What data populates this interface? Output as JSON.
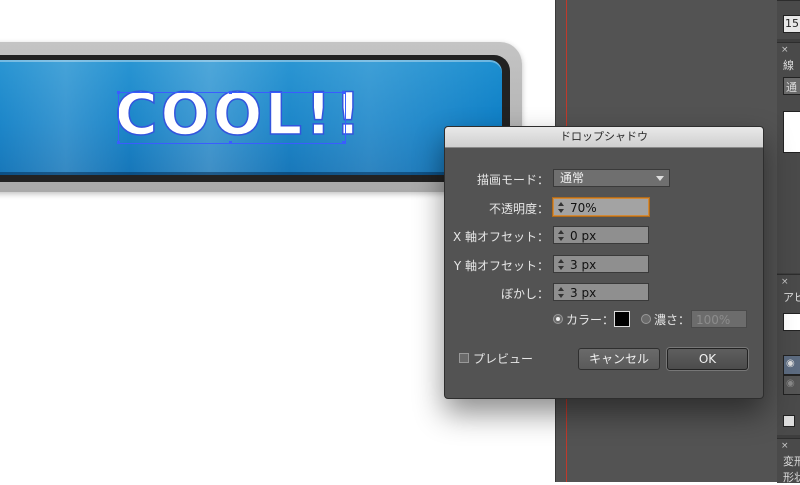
{
  "artboard": {
    "button_text": "COOL!!",
    "button_color": "#0f7fc6"
  },
  "dialog": {
    "title": "ドロップシャドウ",
    "mode": {
      "label": "描画モード：",
      "value": "通常"
    },
    "opacity": {
      "label": "不透明度：",
      "value": "70%"
    },
    "x_offset": {
      "label": "X 軸オフセット：",
      "value": "0 px"
    },
    "y_offset": {
      "label": "Y 軸オフセット：",
      "value": "3 px"
    },
    "blur": {
      "label": "ぼかし：",
      "value": "3 px"
    },
    "color_option": {
      "label": "カラー：",
      "selected": true,
      "swatch": "#000000"
    },
    "darkness_option": {
      "label": "濃さ：",
      "value": "100%",
      "selected": false
    },
    "preview": {
      "label": "プレビュー",
      "checked": false
    },
    "cancel_label": "キャンセル",
    "ok_label": "OK"
  },
  "side_panels": {
    "top_value": "15",
    "stroke_title": "線",
    "stroke_dropdown": "通",
    "appearance_title": "アピ",
    "transform_title": "変形",
    "shape_title": "形状",
    "close_glyph": "×"
  },
  "colors": {
    "panel_bg": "#535353",
    "guide_red": "#c0392b",
    "focus_orange": "#d08a3a",
    "selection_blue": "#3a5cff"
  }
}
